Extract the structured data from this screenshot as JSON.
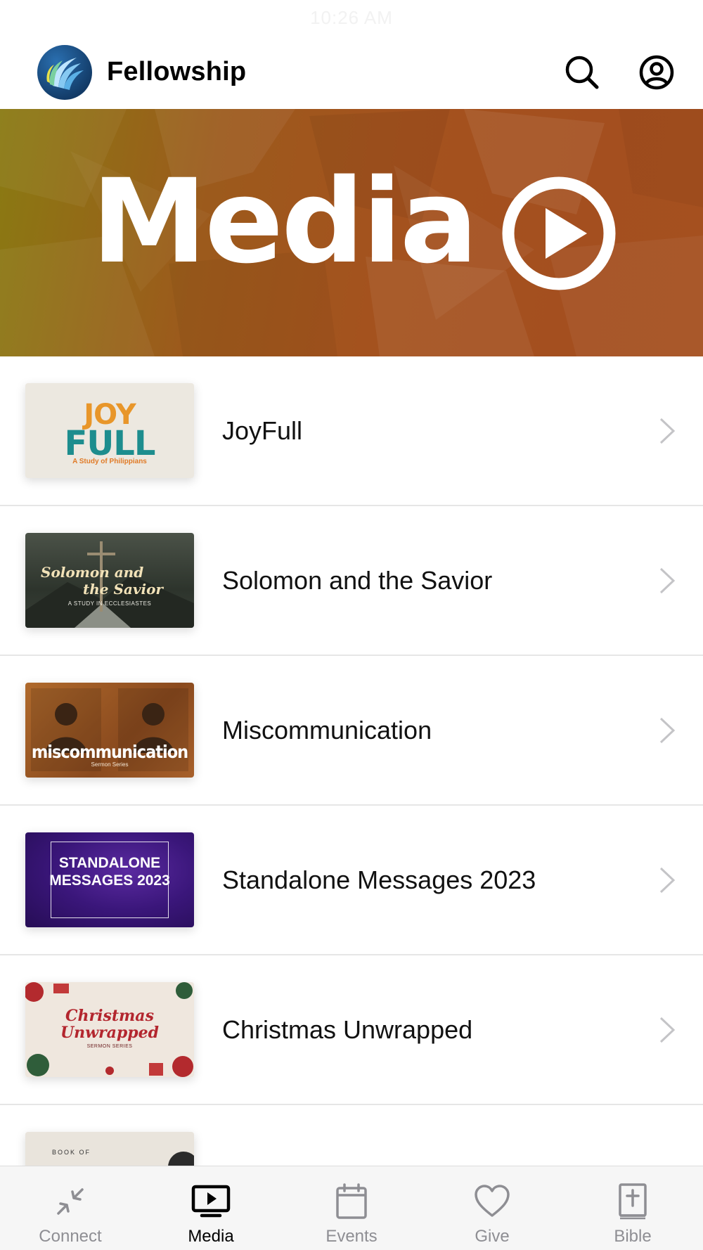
{
  "status_bar": {
    "time": "10:26 AM"
  },
  "header": {
    "app_name": "Fellowship",
    "logo_icon": "fellowship-logo",
    "search_icon": "search-icon",
    "profile_icon": "profile-icon"
  },
  "hero": {
    "title": "Media",
    "play_icon": "play-circle-icon"
  },
  "list": {
    "items": [
      {
        "title": "JoyFull",
        "thumb": {
          "line1": "JOY",
          "line2": "FULL",
          "line3": "A Study of Philippians"
        }
      },
      {
        "title": "Solomon and the Savior",
        "thumb": {
          "line1": "Solomon and",
          "line2": "the Savior",
          "line3": "A STUDY IN ECCLESIASTES"
        }
      },
      {
        "title": "Miscommunication",
        "thumb": {
          "line1": "miscommunication",
          "line2": "Sermon Series"
        }
      },
      {
        "title": "Standalone Messages 2023",
        "thumb": {
          "line1": "STANDALONE MESSAGES 2023"
        }
      },
      {
        "title": "Christmas Unwrapped",
        "thumb": {
          "line1": "Christmas Unwrapped",
          "line2": "SERMON SERIES"
        }
      },
      {
        "title": "",
        "thumb": {
          "line1": "BOOK OF"
        }
      }
    ]
  },
  "tabbar": {
    "tabs": [
      {
        "label": "Connect",
        "icon": "connect-icon",
        "active": false
      },
      {
        "label": "Media",
        "icon": "media-icon",
        "active": true
      },
      {
        "label": "Events",
        "icon": "calendar-icon",
        "active": false
      },
      {
        "label": "Give",
        "icon": "heart-icon",
        "active": false
      },
      {
        "label": "Bible",
        "icon": "bible-icon",
        "active": false
      }
    ]
  },
  "colors": {
    "hero_gradient_start": "#8a7a12",
    "hero_gradient_end": "#a5501f",
    "active_tab": "#000000",
    "inactive_tab": "#8e8e93"
  }
}
